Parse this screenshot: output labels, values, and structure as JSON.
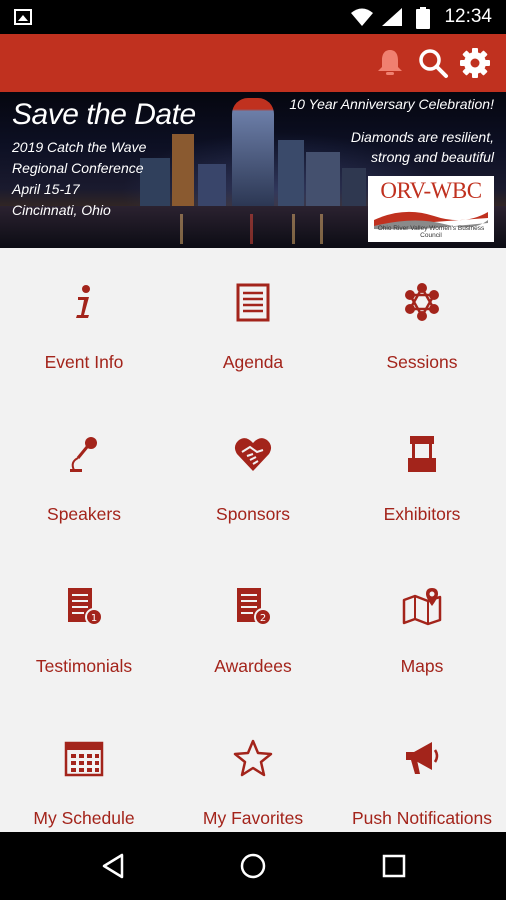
{
  "status_bar": {
    "time": "12:34"
  },
  "app_bar": {
    "icons": [
      "bell-icon",
      "search-icon",
      "gear-icon"
    ],
    "color": "#c0311f"
  },
  "banner": {
    "title": "Save the Date",
    "event_line1": "2019 Catch the Wave",
    "event_line2": "Regional Conference",
    "event_line3": "April 15-17",
    "event_line4": "Cincinnati, Ohio",
    "anniversary": "10 Year Anniversary Celebration!",
    "tagline1": "Diamonds are resilient,",
    "tagline2": "strong and beautiful",
    "logo_text": "ORV-WBC",
    "logo_subtext": "Ohio River Valley Women's Business Council"
  },
  "menu": [
    {
      "label": "Event Info",
      "icon": "info-icon"
    },
    {
      "label": "Agenda",
      "icon": "agenda-icon"
    },
    {
      "label": "Sessions",
      "icon": "sessions-icon"
    },
    {
      "label": "Speakers",
      "icon": "microphone-icon"
    },
    {
      "label": "Sponsors",
      "icon": "handshake-heart-icon"
    },
    {
      "label": "Exhibitors",
      "icon": "booth-icon"
    },
    {
      "label": "Testimonials",
      "icon": "list-badge-1-icon"
    },
    {
      "label": "Awardees",
      "icon": "list-badge-2-icon"
    },
    {
      "label": "Maps",
      "icon": "map-icon"
    },
    {
      "label": "My Schedule",
      "icon": "calendar-icon"
    },
    {
      "label": "My Favorites",
      "icon": "star-icon"
    },
    {
      "label": "Push Notifications",
      "icon": "megaphone-icon"
    }
  ],
  "accent_color": "#a3241b"
}
